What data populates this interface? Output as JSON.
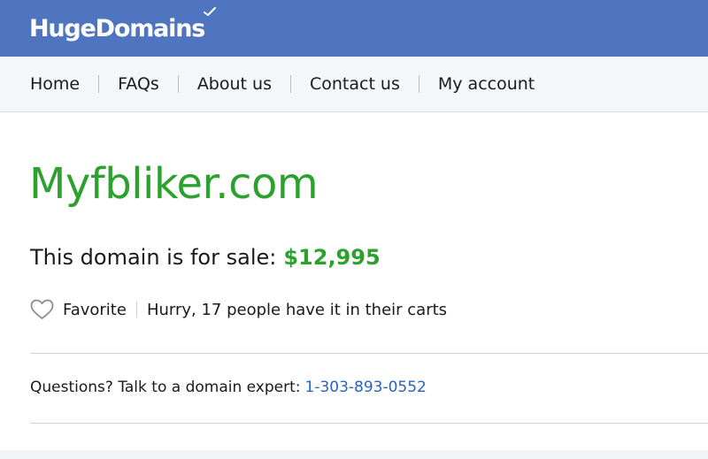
{
  "header": {
    "logo_text": "HugeDomains",
    "brand_color": "#4f75c0"
  },
  "nav": {
    "items": [
      {
        "label": "Home"
      },
      {
        "label": "FAQs"
      },
      {
        "label": "About us"
      },
      {
        "label": "Contact us"
      },
      {
        "label": "My account"
      }
    ]
  },
  "main": {
    "domain_name": "Myfbliker.com",
    "sale_text": "This domain is for sale:",
    "price": "$12,995",
    "favorite_label": "Favorite",
    "cart_notice": "Hurry, 17 people have it in their carts",
    "questions_text": "Questions? Talk to a domain expert:",
    "phone": "1-303-893-0552",
    "accent_color": "#2da12d",
    "link_color": "#2a62c4",
    "icons": {
      "favorite": "heart-outline-icon",
      "logo_mark": "checkmark-icon"
    }
  }
}
